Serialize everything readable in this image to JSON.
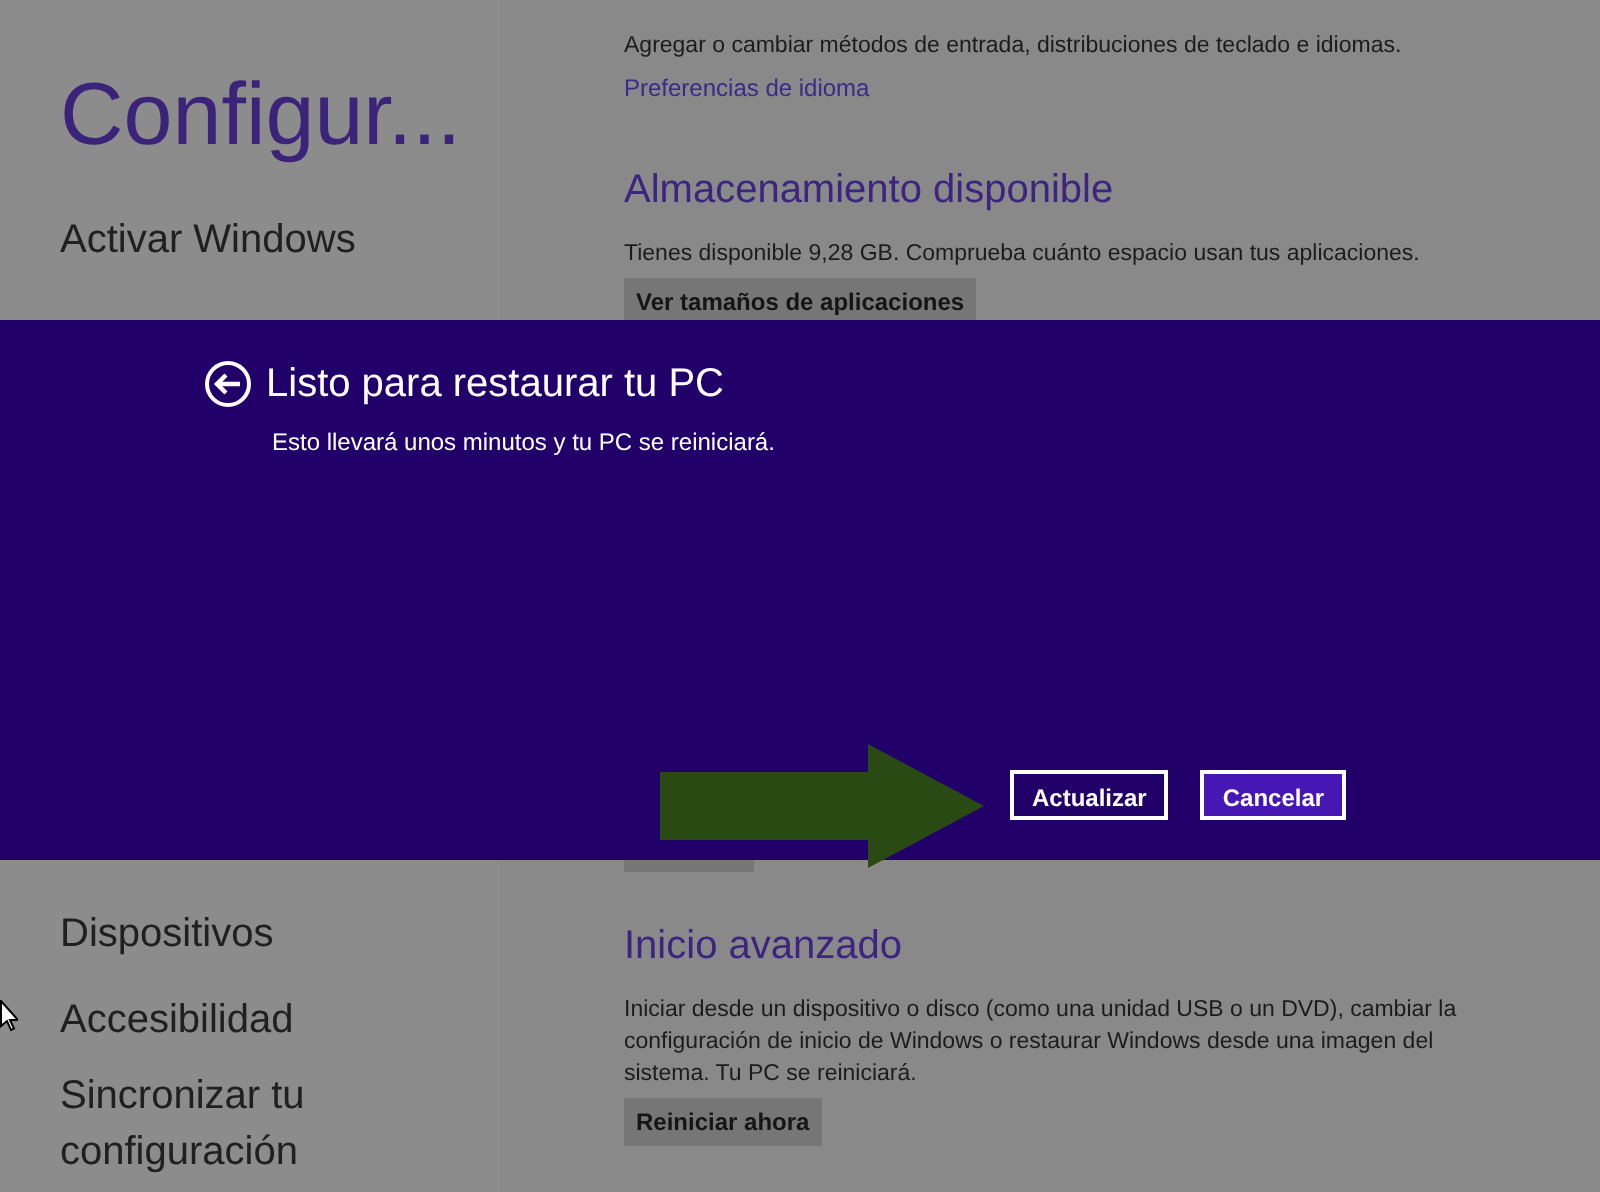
{
  "sidebar": {
    "title": "Configur...",
    "items": [
      {
        "label": "Activar Windows"
      },
      {
        "label": "Dispositivos"
      },
      {
        "label": "Accesibilidad"
      },
      {
        "label": "Sincronizar tu configuración"
      }
    ]
  },
  "content": {
    "sections": [
      {
        "description": "Agregar o cambiar métodos de entrada, distribuciones de teclado e idiomas.",
        "link": "Preferencias de idioma"
      },
      {
        "heading": "Almacenamiento disponible",
        "description": "Tienes disponible 9,28 GB. Comprueba cuánto espacio usan tus aplicaciones.",
        "button": "Ver tamaños de aplicaciones"
      },
      {
        "heading": "Inicio avanzado",
        "description": "Iniciar desde un dispositivo o disco (como una unidad USB o un DVD), cambiar la configuración de inicio de Windows o restaurar Windows desde una imagen del sistema. Tu PC se reiniciará.",
        "button": "Reiniciar ahora"
      }
    ]
  },
  "dialog": {
    "title": "Listo para restaurar tu PC",
    "message": "Esto llevará unos minutos y tu PC se reiniciará.",
    "buttons": [
      {
        "label": "Actualizar",
        "primary": false
      },
      {
        "label": "Cancelar",
        "primary": true
      }
    ]
  }
}
